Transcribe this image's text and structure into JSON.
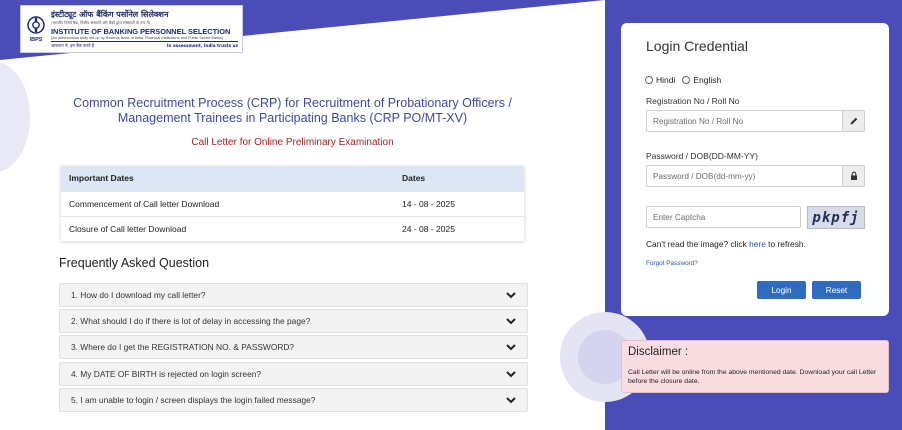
{
  "header": {
    "logo": {
      "hindi_name": "इंस्टीट्यूट ऑफ बैंकिंग पर्सोनेल सिलेक्शन",
      "hindi_subtext": "(भारतीय रिज़र्व बैंक, वित्तीय संस्थानों और बैंकों द्वारा सोसाइटी के रूप में)",
      "english_name": "INSTITUTE OF BANKING PERSONNEL SELECTION",
      "english_subtext": "(An autonomous body set up by Reserve Bank of India, Financial Institutions and Public Sector Banks)",
      "hindi_tagline": "आकलन में, हम बैंक करते हैं",
      "english_tagline": "In assessment, India trusts us",
      "mark_text": "IBPS"
    }
  },
  "main": {
    "title": "Common Recruitment Process (CRP) for Recruitment of Probationary Officers / Management Trainees in Participating Banks (CRP PO/MT-XV)",
    "subtitle": "Call Letter for Online Preliminary Examination",
    "dates_table": {
      "headers": [
        "Important Dates",
        "Dates"
      ],
      "rows": [
        [
          "Commencement of Call letter Download",
          "14 - 08 - 2025"
        ],
        [
          "Closure of Call letter Download",
          "24 - 08 - 2025"
        ]
      ]
    },
    "faq": {
      "heading": "Frequently Asked Question",
      "items": [
        "1. How do I download my call letter?",
        "2. What should I do if there is lot of delay in accessing the page?",
        "3. Where do I get the REGISTRATION NO. & PASSWORD?",
        "4. My DATE OF BIRTH is rejected on login screen?",
        "5. I am unable to login / screen displays the login failed message?"
      ]
    }
  },
  "login": {
    "title": "Login Credential",
    "language_options": [
      "Hindi",
      "English"
    ],
    "registration_label": "Registration No / Roll No",
    "registration_placeholder": "Registration No / Roll No",
    "password_label": "Password / DOB(DD-MM-YY)",
    "password_placeholder": "Password / DOB(dd-mm-yy)",
    "captcha_placeholder": "Enter Captcha",
    "captcha_text": "pkpfj",
    "refresh_prefix": "Can't read the image? click ",
    "refresh_link": "here",
    "refresh_suffix": " to refresh.",
    "forgot_password": "Forgot Password?",
    "login_button": "Login",
    "reset_button": "Reset"
  },
  "disclaimer": {
    "title": "Disclaimer :",
    "text": "Call Letter will be online from the above mentioned date. Download your call Letter before the closure date."
  },
  "colors": {
    "brand_purple": "#4a4cb8",
    "title_blue": "#3c4aa0",
    "subtitle_red": "#a02323",
    "button_blue": "#2f6cc0",
    "disclaimer_bg": "#f9dde0"
  }
}
